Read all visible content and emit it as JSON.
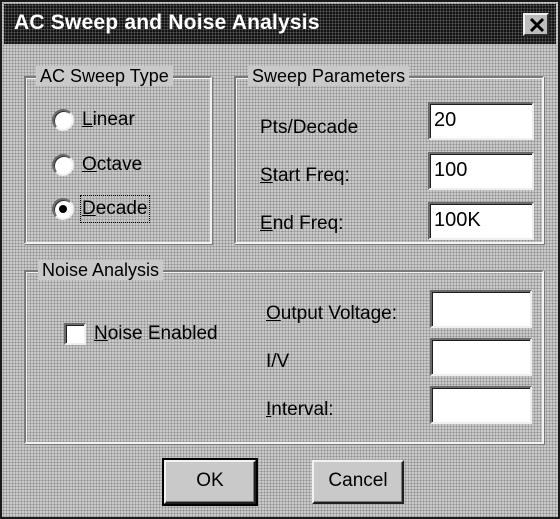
{
  "dialog": {
    "title": "AC Sweep and Noise Analysis"
  },
  "ac_sweep_type": {
    "legend": "AC Sweep Type",
    "options": [
      {
        "mnemonic": "L",
        "rest": "inear",
        "selected": false
      },
      {
        "mnemonic": "O",
        "rest": "ctave",
        "selected": false
      },
      {
        "mnemonic": "D",
        "rest": "ecade",
        "selected": true
      }
    ]
  },
  "sweep_parameters": {
    "legend": "Sweep Parameters",
    "fields": [
      {
        "prefix": "",
        "mnemonic": "",
        "rest": "Pts/Decade",
        "value": "20"
      },
      {
        "prefix": "",
        "mnemonic": "S",
        "rest": "tart Freq:",
        "value": "100"
      },
      {
        "prefix": "",
        "mnemonic": "E",
        "rest": "nd Freq:",
        "value": "100K"
      }
    ]
  },
  "noise_analysis": {
    "legend": "Noise Analysis",
    "noise_enabled": {
      "mnemonic": "N",
      "rest": "oise Enabled",
      "checked": false
    },
    "fields": [
      {
        "prefix": "",
        "mnemonic": "O",
        "rest": "utput Voltage:",
        "value": ""
      },
      {
        "prefix": "",
        "mnemonic": "",
        "rest": "I/V",
        "value": ""
      },
      {
        "prefix": "",
        "mnemonic": "I",
        "rest": "nterval:",
        "value": ""
      }
    ]
  },
  "buttons": {
    "ok": "OK",
    "cancel": "Cancel"
  }
}
